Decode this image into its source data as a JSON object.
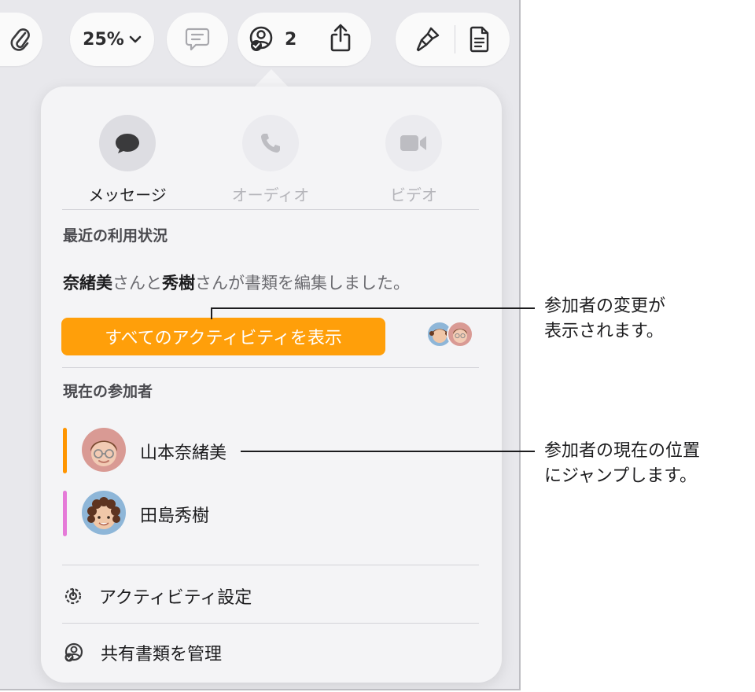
{
  "toolbar": {
    "zoom_label": "25%",
    "collaborators_count": "2"
  },
  "popover": {
    "communication": [
      {
        "label": "メッセージ",
        "icon": "message-bubble-icon",
        "enabled": true
      },
      {
        "label": "オーディオ",
        "icon": "phone-icon",
        "enabled": false
      },
      {
        "label": "ビデオ",
        "icon": "video-camera-icon",
        "enabled": false
      }
    ],
    "recent_activity": {
      "title": "最近の利用状況",
      "name_1": "奈緒美",
      "text_1": "さんと",
      "name_2": "秀樹",
      "text_2": "さんが書類を編集しました。",
      "button_label": "すべてのアクティビティを表示"
    },
    "current_participants": {
      "title": "現在の参加者",
      "participants": [
        {
          "name": "山本奈緒美",
          "color": "#ff9500"
        },
        {
          "name": "田島秀樹",
          "color": "#e57ad8"
        }
      ]
    },
    "menu": {
      "activity_settings": "アクティビティ設定",
      "manage_shared": "共有書類を管理"
    }
  },
  "callouts": {
    "changes_line1": "参加者の変更が",
    "changes_line2": "表示されます。",
    "jump_line1": "参加者の現在の位置",
    "jump_line2": "にジャンプします。"
  },
  "colors": {
    "accent_orange": "#ff9f0a",
    "participant_orange": "#ff9500",
    "participant_pink": "#e57ad8"
  }
}
